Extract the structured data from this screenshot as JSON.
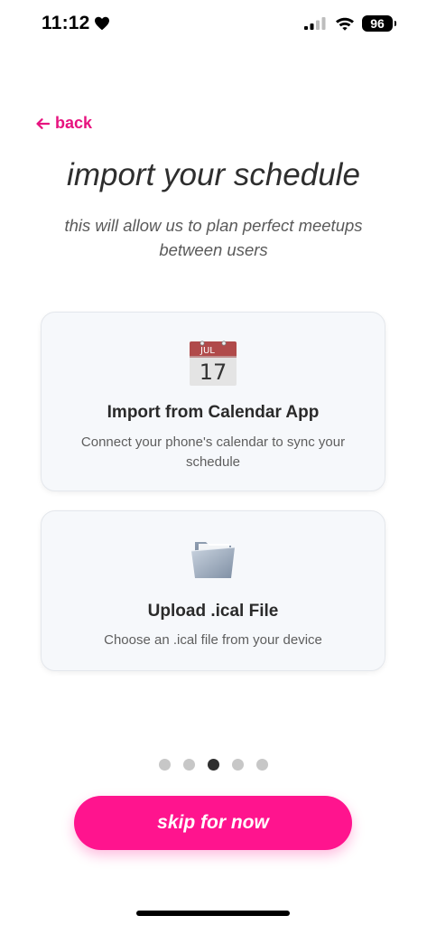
{
  "status_bar": {
    "time": "11:12",
    "battery": "96",
    "icons": [
      "heart-icon",
      "signal-icon",
      "wifi-icon",
      "battery-icon"
    ]
  },
  "nav": {
    "back_label": "back",
    "back_icon": "arrow-left-icon"
  },
  "header": {
    "title": "import your schedule",
    "subtitle": "this will allow us to plan perfect meetups between users"
  },
  "options": [
    {
      "icon": "calendar-icon",
      "icon_month": "JUL",
      "icon_day": "17",
      "title": "Import from Calendar App",
      "description": "Connect your phone's calendar to sync your schedule"
    },
    {
      "icon": "folder-icon",
      "title": "Upload .ical File",
      "description": "Choose an .ical file from your device"
    }
  ],
  "pagination": {
    "total": 5,
    "current": 3
  },
  "actions": {
    "skip_label": "skip for now"
  },
  "colors": {
    "accent": "#ff148e",
    "back_link": "#e7137f",
    "card_bg": "#f6f8fb",
    "dot_active": "#2f2f2f",
    "dot_inactive": "#c7c7c7"
  }
}
